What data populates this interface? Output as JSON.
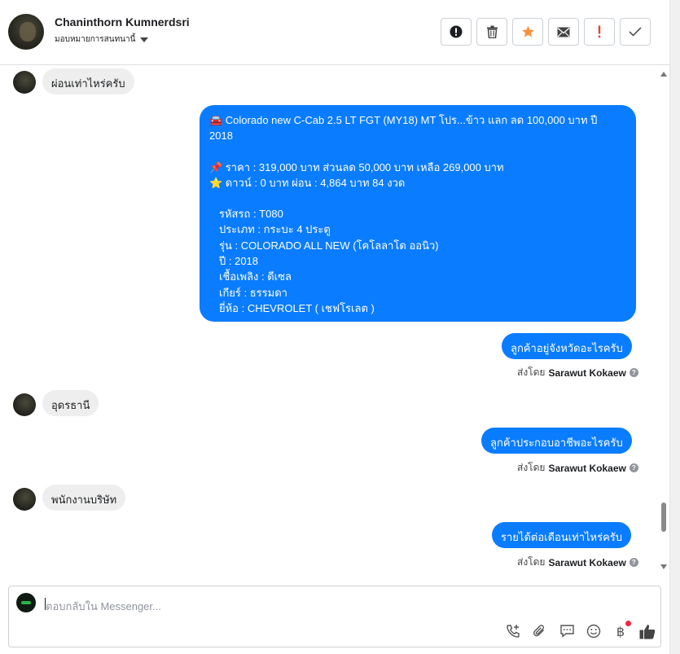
{
  "header": {
    "contact_name": "Chaninthorn Kumnerdsri",
    "assign_label": "มอบหมายการสนทนานี้",
    "actions": [
      {
        "icon": "alert-circle-icon",
        "name": "mark-spam-button"
      },
      {
        "icon": "trash-icon",
        "name": "delete-button"
      },
      {
        "icon": "star-icon",
        "name": "star-button"
      },
      {
        "icon": "envelope-icon",
        "name": "mark-unread-button"
      },
      {
        "icon": "exclamation-icon",
        "name": "follow-up-button"
      },
      {
        "icon": "check-icon",
        "name": "mark-done-button"
      }
    ],
    "star_color": "#f7923b",
    "follow_color": "#e8412c"
  },
  "thread": {
    "msg1": "ผ่อนเท่าไหร่ครับ",
    "big_message": {
      "l1": "🚘 Colorado new C-Cab 2.5 LT FGT (MY18) MT โปร...ข้าว แลก ลด 100,000 บาท ปี",
      "l2": "2018",
      "l3": "📌 ราคา : 319,000 บาท ส่วนลด 50,000 บาท เหลือ 269,000 บาท",
      "l4": "⭐ ดาวน์ : 0 บาท ผ่อน : 4,864 บาท 84 งวด",
      "l5": "รหัสรถ : T080",
      "l6": "ประเภท : กระบะ 4 ประตู",
      "l7": "รุ่น : COLORADO ALL NEW (โคโลลาโด ออนิว)",
      "l8": "ปี : 2018",
      "l9": "เชื้อเพลิง : ดีเซล",
      "l10": "เกียร์ : ธรรมดา",
      "l11": "ยี่ห้อ : CHEVROLET ( เชฟโรเลต )"
    },
    "msg2": "ลูกค้าอยู่จังหวัดอะไรครับ",
    "msg3": "อุดรธานี",
    "msg4": "ลูกค้าประกอบอาชีพอะไรครับ",
    "msg5": "พนักงานบริษัท",
    "msg6": "รายได้ต่อเดือนเท่าไหร่ครับ",
    "sent_by_prefix": "ส่งโดย",
    "sender": "Sarawut Kokaew",
    "outgoing_color": "#0a7cff",
    "incoming_color": "#eeeeee"
  },
  "composer": {
    "placeholder": "ตอบกลับใน Messenger...",
    "tools": [
      "phone-add-icon",
      "attachment-icon",
      "speech-bubble-icon",
      "smiley-icon",
      "baht-icon",
      "thumbs-up-icon"
    ]
  }
}
